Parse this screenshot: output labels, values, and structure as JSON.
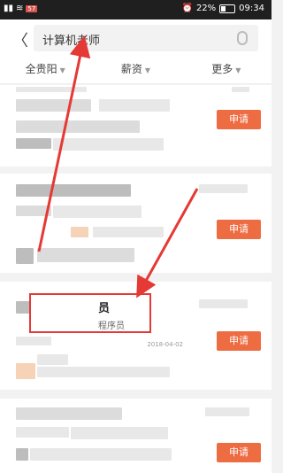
{
  "statusbar": {
    "badge": "57",
    "battery": "22%",
    "time": "09:34"
  },
  "search": {
    "query": "计算机老师"
  },
  "filters": [
    {
      "label": "全贵阳"
    },
    {
      "label": "薪资"
    },
    {
      "label": "更多"
    }
  ],
  "apply_label": "申请",
  "highlight": {
    "title": "员",
    "subtitle": "程序员"
  },
  "date_text": "2018-04-02",
  "colors": {
    "accent": "#ee6c42",
    "annotation": "#e53935"
  },
  "icons": [
    "back-arrow-icon",
    "mic-icon",
    "battery-icon",
    "signal-icon",
    "wifi-icon",
    "alarm-icon"
  ]
}
